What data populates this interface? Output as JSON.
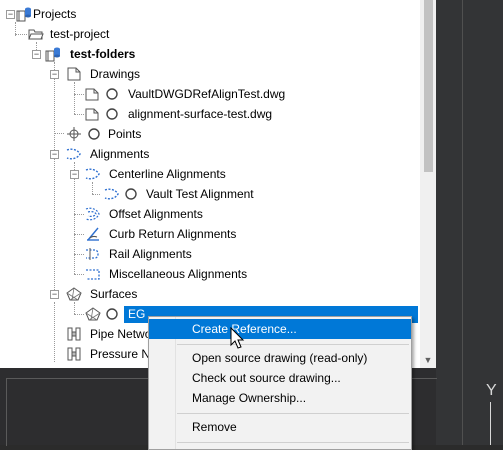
{
  "tree": {
    "projects": "Projects",
    "test_project": "test-project",
    "test_folders": "test-folders",
    "drawings": "Drawings",
    "drawing_1": "VaultDWGDRefAlignTest.dwg",
    "drawing_2": "alignment-surface-test.dwg",
    "points": "Points",
    "alignments": "Alignments",
    "centerline_alignments": "Centerline Alignments",
    "vault_test_alignment": "Vault Test Alignment",
    "offset_alignments": "Offset Alignments",
    "curb_return_alignments": "Curb Return Alignments",
    "rail_alignments": "Rail Alignments",
    "misc_alignments": "Miscellaneous Alignments",
    "surfaces": "Surfaces",
    "eg": "EG",
    "pipe_networks": "Pipe Networ",
    "pressure_networks": "Pressure Ne"
  },
  "context_menu": {
    "create_reference": "Create Reference...",
    "open_source": "Open source drawing (read-only)",
    "check_out": "Check out source drawing...",
    "manage_ownership": "Manage Ownership...",
    "remove": "Remove"
  },
  "viewport": {
    "axis_label": "Y"
  },
  "colors": {
    "selection": "#0078d7",
    "menu_bg": "#f2f2f2"
  }
}
